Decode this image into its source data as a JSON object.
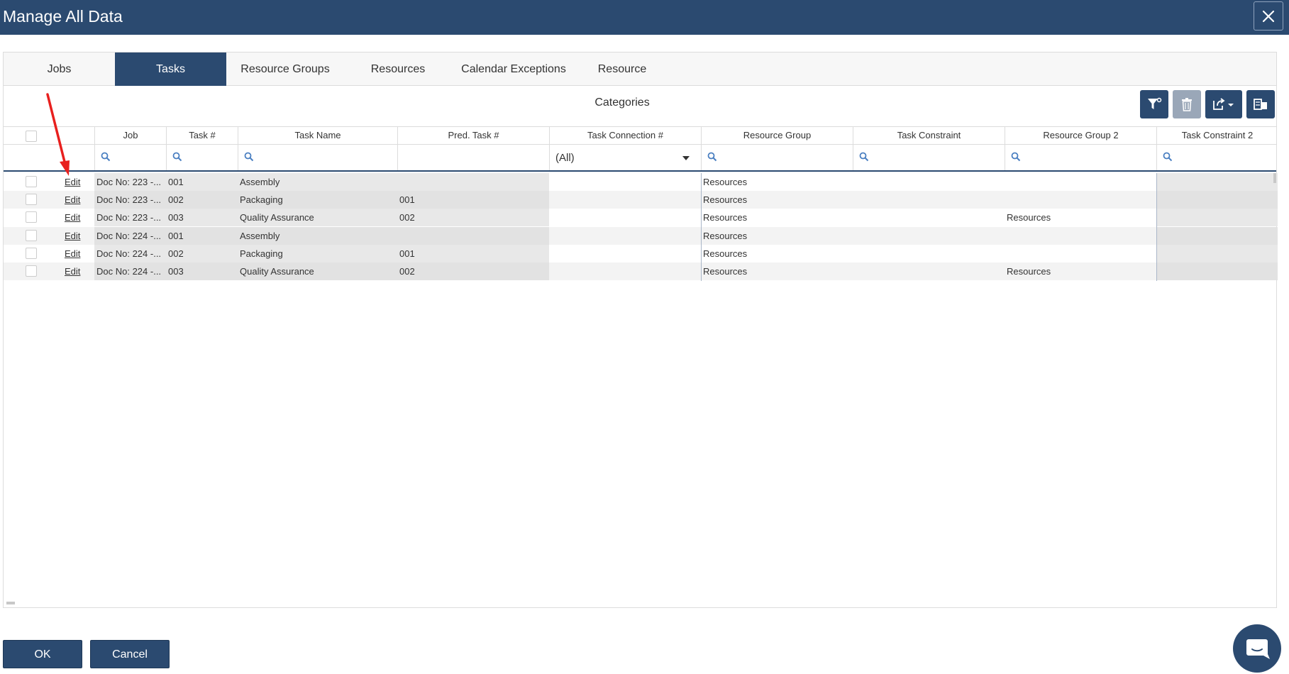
{
  "window": {
    "title": "Manage All Data"
  },
  "tabs": [
    {
      "label": "Jobs",
      "active": false
    },
    {
      "label": "Tasks",
      "active": true
    },
    {
      "label": "Resource Groups",
      "active": false
    },
    {
      "label": "Resources",
      "active": false
    },
    {
      "label": "Calendar Exceptions",
      "active": false
    },
    {
      "label": "Resource Categories",
      "active": false
    }
  ],
  "toolbar": {
    "icons": [
      "filter-reset-icon",
      "delete-icon",
      "export-icon",
      "column-chooser-icon"
    ]
  },
  "grid": {
    "columns": [
      {
        "label": ""
      },
      {
        "label": ""
      },
      {
        "label": "Job"
      },
      {
        "label": "Task #"
      },
      {
        "label": "Task Name"
      },
      {
        "label": "Pred. Task #"
      },
      {
        "label": "Task Connection #"
      },
      {
        "label": "Resource Group"
      },
      {
        "label": "Task Constraint"
      },
      {
        "label": "Resource Group 2"
      },
      {
        "label": "Task Constraint 2"
      }
    ],
    "filter_dropdown_value": "(All)",
    "edit_label": "Edit",
    "rows": [
      {
        "job": "Doc No: 223 -...",
        "task_no": "001",
        "task_name": "Assembly",
        "pred": "",
        "conn": "",
        "rg": "Resources",
        "tc": "",
        "rg2": "",
        "tc2": ""
      },
      {
        "job": "Doc No: 223 -...",
        "task_no": "002",
        "task_name": "Packaging",
        "pred": "001",
        "conn": "",
        "rg": "Resources",
        "tc": "",
        "rg2": "",
        "tc2": ""
      },
      {
        "job": "Doc No: 223 -...",
        "task_no": "003",
        "task_name": "Quality Assurance",
        "pred": "002",
        "conn": "",
        "rg": "Resources",
        "tc": "",
        "rg2": "Resources",
        "tc2": ""
      },
      {
        "job": "Doc No: 224 -...",
        "task_no": "001",
        "task_name": "Assembly",
        "pred": "",
        "conn": "",
        "rg": "Resources",
        "tc": "",
        "rg2": "",
        "tc2": ""
      },
      {
        "job": "Doc No: 224 -...",
        "task_no": "002",
        "task_name": "Packaging",
        "pred": "001",
        "conn": "",
        "rg": "Resources",
        "tc": "",
        "rg2": "",
        "tc2": ""
      },
      {
        "job": "Doc No: 224 -...",
        "task_no": "003",
        "task_name": "Quality Assurance",
        "pred": "002",
        "conn": "",
        "rg": "Resources",
        "tc": "",
        "rg2": "Resources",
        "tc2": ""
      }
    ]
  },
  "footer": {
    "ok_label": "OK",
    "cancel_label": "Cancel"
  },
  "colors": {
    "primary": "#2b4a70",
    "annotation_arrow": "#e8201e"
  }
}
